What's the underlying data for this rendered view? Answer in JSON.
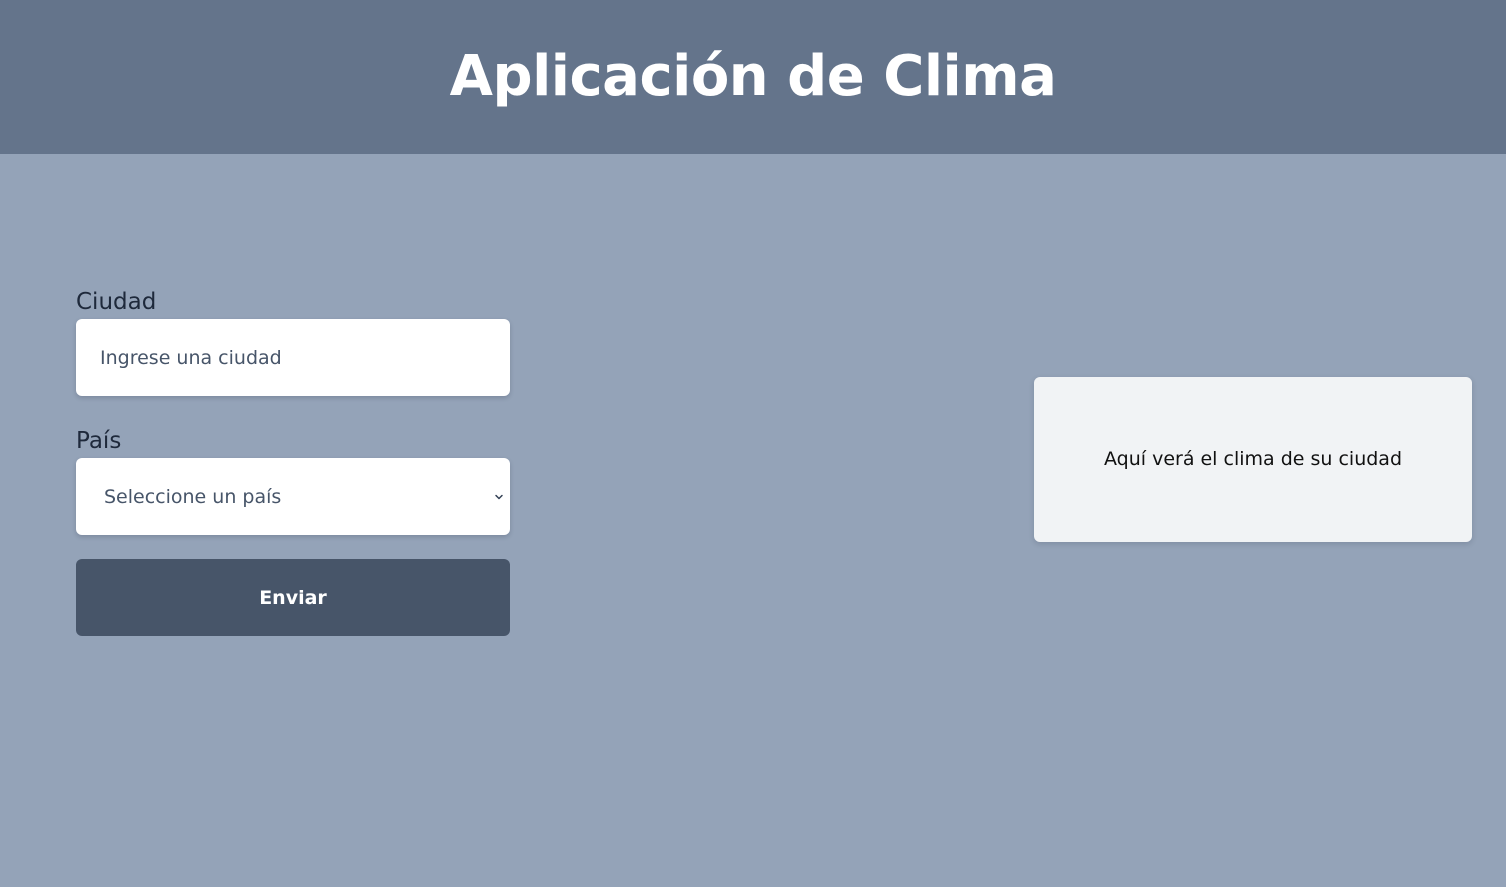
{
  "header": {
    "title": "Aplicación de Clima"
  },
  "form": {
    "city": {
      "label": "Ciudad",
      "value": "",
      "placeholder": "Ingrese una ciudad"
    },
    "country": {
      "label": "País",
      "selected": "Seleccione un país",
      "icon": "chevron-down-icon"
    },
    "submit_label": "Enviar"
  },
  "result": {
    "message": "Aquí verá el clima de su ciudad"
  },
  "colors": {
    "header_background": "#64748b",
    "page_background": "#94a3b8",
    "button_background": "#475569",
    "result_card_background": "#f1f3f5"
  }
}
